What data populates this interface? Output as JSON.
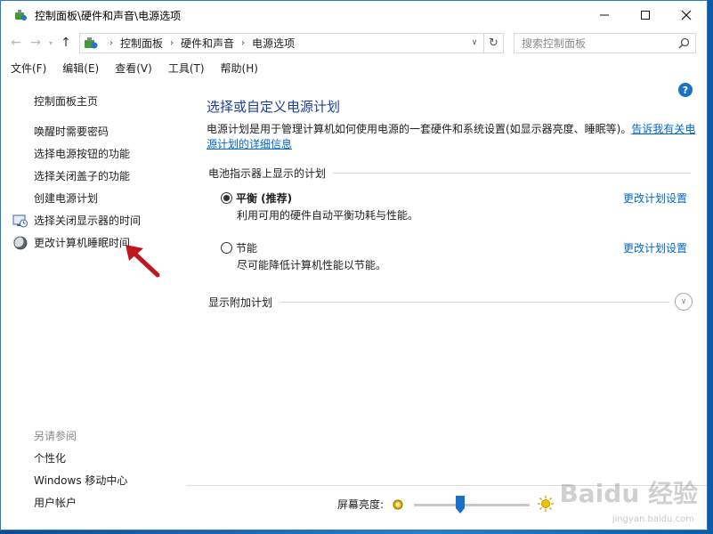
{
  "window": {
    "title": "控制面板\\硬件和声音\\电源选项"
  },
  "address": {
    "crumbs": [
      "控制面板",
      "硬件和声音",
      "电源选项"
    ]
  },
  "search": {
    "placeholder": "搜索控制面板"
  },
  "menubar": {
    "items": [
      "文件(F)",
      "编辑(E)",
      "查看(V)",
      "工具(T)",
      "帮助(H)"
    ]
  },
  "sidebar": {
    "home": "控制面板主页",
    "tasks": [
      {
        "label": "唤醒时需要密码",
        "icon": ""
      },
      {
        "label": "选择电源按钮的功能",
        "icon": ""
      },
      {
        "label": "选择关闭盖子的功能",
        "icon": ""
      },
      {
        "label": "创建电源计划",
        "icon": ""
      },
      {
        "label": "选择关闭显示器的时间",
        "icon": "monitor-clock-icon"
      },
      {
        "label": "更改计算机睡眠时间",
        "icon": "moon-icon"
      }
    ],
    "see_also": {
      "header": "另请参阅",
      "links": [
        "个性化",
        "Windows 移动中心",
        "用户帐户"
      ]
    }
  },
  "main": {
    "heading": "选择或自定义电源计划",
    "description": "电源计划是用于管理计算机如何使用电源的一套硬件和系统设置(如显示器亮度、睡眠等)。",
    "description_link": "告诉我有关电源计划的详细信息",
    "section_header": "电池指示器上显示的计划",
    "plans": [
      {
        "name": "平衡 (推荐)",
        "subtitle": "利用可用的硬件自动平衡功耗与性能。",
        "selected": true,
        "change_link": "更改计划设置"
      },
      {
        "name": "节能",
        "subtitle": "尽可能降低计算机性能以节能。",
        "selected": false,
        "change_link": "更改计划设置"
      }
    ],
    "additional_plans": "显示附加计划"
  },
  "bottom": {
    "brightness_label": "屏幕亮度:",
    "brightness_level": 0.4
  },
  "watermark": {
    "text": "Baidu 经验",
    "sub": "jingyan.baidu.com"
  },
  "colors": {
    "link": "#0066cc",
    "heading": "#1d3f99",
    "accent": "#1a6fc7",
    "annotation": "#c0161c"
  }
}
